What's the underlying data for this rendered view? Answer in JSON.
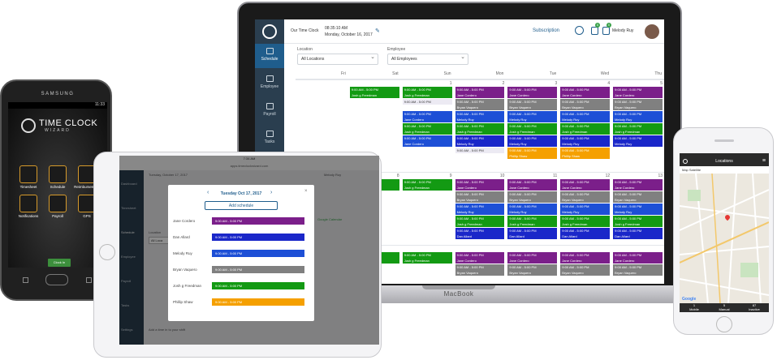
{
  "macbook": {
    "brand": "MacBook",
    "app_title": "Our Time Clock",
    "time": "08:35:10 AM",
    "date": "Monday, October 16, 2017",
    "subscription": "Subscription",
    "user_name": "Melody Ruy",
    "badge_a": "0",
    "badge_b": "0",
    "sidebar": [
      {
        "label": "Schedule",
        "icon": "calendar-icon",
        "active": true
      },
      {
        "label": "Employee",
        "icon": "employee-icon",
        "active": false
      },
      {
        "label": "Payroll",
        "icon": "payroll-icon",
        "active": false
      },
      {
        "label": "Tasks",
        "icon": "tasks-icon",
        "active": false
      }
    ],
    "filters": {
      "location_label": "Location",
      "location_value": "All Locations",
      "employee_label": "Employee",
      "employee_value": "All Employees"
    },
    "days": [
      "Fri",
      "Sat",
      "Sun",
      "Mon",
      "Tue",
      "Wed",
      "Thu"
    ],
    "week_numbers": [
      [
        "",
        "",
        "1",
        "2",
        "3",
        "4",
        "5"
      ],
      [
        "7",
        "8",
        "9",
        "10",
        "11",
        "12",
        "13"
      ],
      [
        "",
        "",
        "",
        "",
        "",
        "",
        ""
      ]
    ],
    "shift_time": "9:00 AM - 5:00 PM",
    "vacation": "Vacation",
    "names": [
      "Jane Cordero",
      "Dan Allard",
      "Melody Ruy",
      "Bryan Vaquero",
      "Josh g Freedman",
      "Phillip Shaw"
    ],
    "colors": {
      "purple": "#7b1f8a",
      "gray": "#808080",
      "blue": "#1d4fd6",
      "green": "#139a13",
      "darkblue": "#1a27c9",
      "orange": "#f5a000"
    }
  },
  "android": {
    "brand": "SAMSUNG",
    "status_time": "11:33",
    "title": "TIME CLOCK",
    "subtitle": "WIZARD",
    "tiles": [
      "Timesheet",
      "Schedule",
      "Reimbursement",
      "Notifications",
      "Payroll",
      "GPS"
    ],
    "clock_in": "Clock In"
  },
  "ipad": {
    "status_time": "7:34 AM",
    "url": "apps.timeclockwizard.com",
    "background_date": "Tuesday, October 17, 2017",
    "user": "Melody Ruy",
    "modal_date": "Tuesday Oct 17, 2017",
    "add_schedule": "Add schedule",
    "side_labels": [
      "Dashboard",
      "Timesheet",
      "Schedule",
      "Employee",
      "Payroll",
      "Tasks",
      "Settings"
    ],
    "location_label": "Location",
    "location_value": "All Loca",
    "google_calendar": "Google Calendar",
    "rows": [
      {
        "name": "Jane Cordero",
        "time": "9:00 AM - 5:00 PM",
        "color": "#7b1f8a"
      },
      {
        "name": "Dan Allard",
        "time": "9:00 AM - 5:00 PM",
        "color": "#1a27c9"
      },
      {
        "name": "Melody Ruy",
        "time": "9:00 AM - 5:00 PM",
        "color": "#1d4fd6"
      },
      {
        "name": "Bryan Vaquero",
        "time": "9:00 AM - 5:00 PM",
        "color": "#808080"
      },
      {
        "name": "Josh g Freedman",
        "time": "9:00 AM - 5:00 PM",
        "color": "#139a13"
      },
      {
        "name": "Phillip Shaw",
        "time": "9:00 AM - 5:00 PM",
        "color": "#f5a000"
      }
    ],
    "footer_note": "Add a time in to your shift"
  },
  "iphone": {
    "title": "Locations",
    "tabs": "Map   Satellite",
    "footer": [
      {
        "count": "1",
        "label": "Mobile"
      },
      {
        "count": "5",
        "label": "Manual"
      },
      {
        "count": "87",
        "label": "Inactive"
      }
    ],
    "google": "Google"
  }
}
